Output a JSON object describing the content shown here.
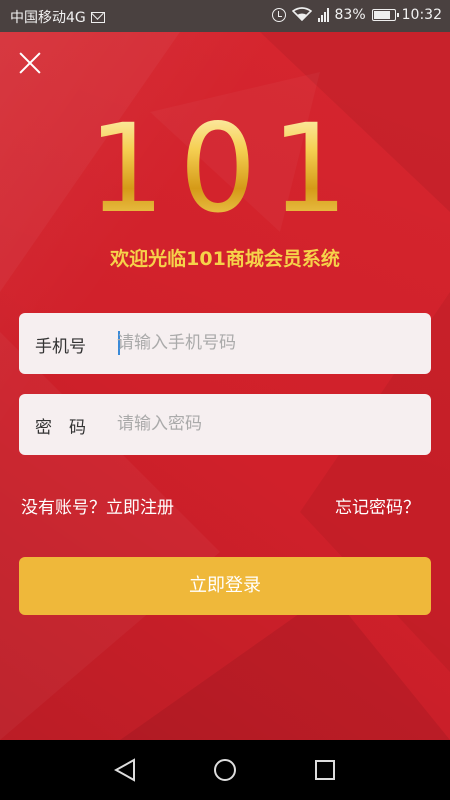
{
  "status_bar": {
    "carrier": "中国移动4G",
    "battery": "83%",
    "time": "10:32",
    "icons": [
      "mail-icon",
      "alarm-icon",
      "wifi-icon",
      "signal-icon",
      "battery-icon"
    ]
  },
  "header": {
    "close_icon": "close-icon",
    "logo_text": "101",
    "welcome": "欢迎光临101商城会员系统"
  },
  "form": {
    "phone_label": "手机号",
    "phone_placeholder": "请输入手机号码",
    "password_label": "密　码",
    "password_placeholder": "请输入密码"
  },
  "links": {
    "register": "没有账号？立即注册",
    "forgot": "忘记密码？"
  },
  "login_button": "立即登录",
  "colors": {
    "background": "#d0202a",
    "accent_gold": "#f6d24a",
    "button": "#efb83a",
    "field_bg": "#f6eff0"
  },
  "nav_bar": {
    "icons": [
      "back-icon",
      "home-icon",
      "recent-apps-icon"
    ]
  }
}
